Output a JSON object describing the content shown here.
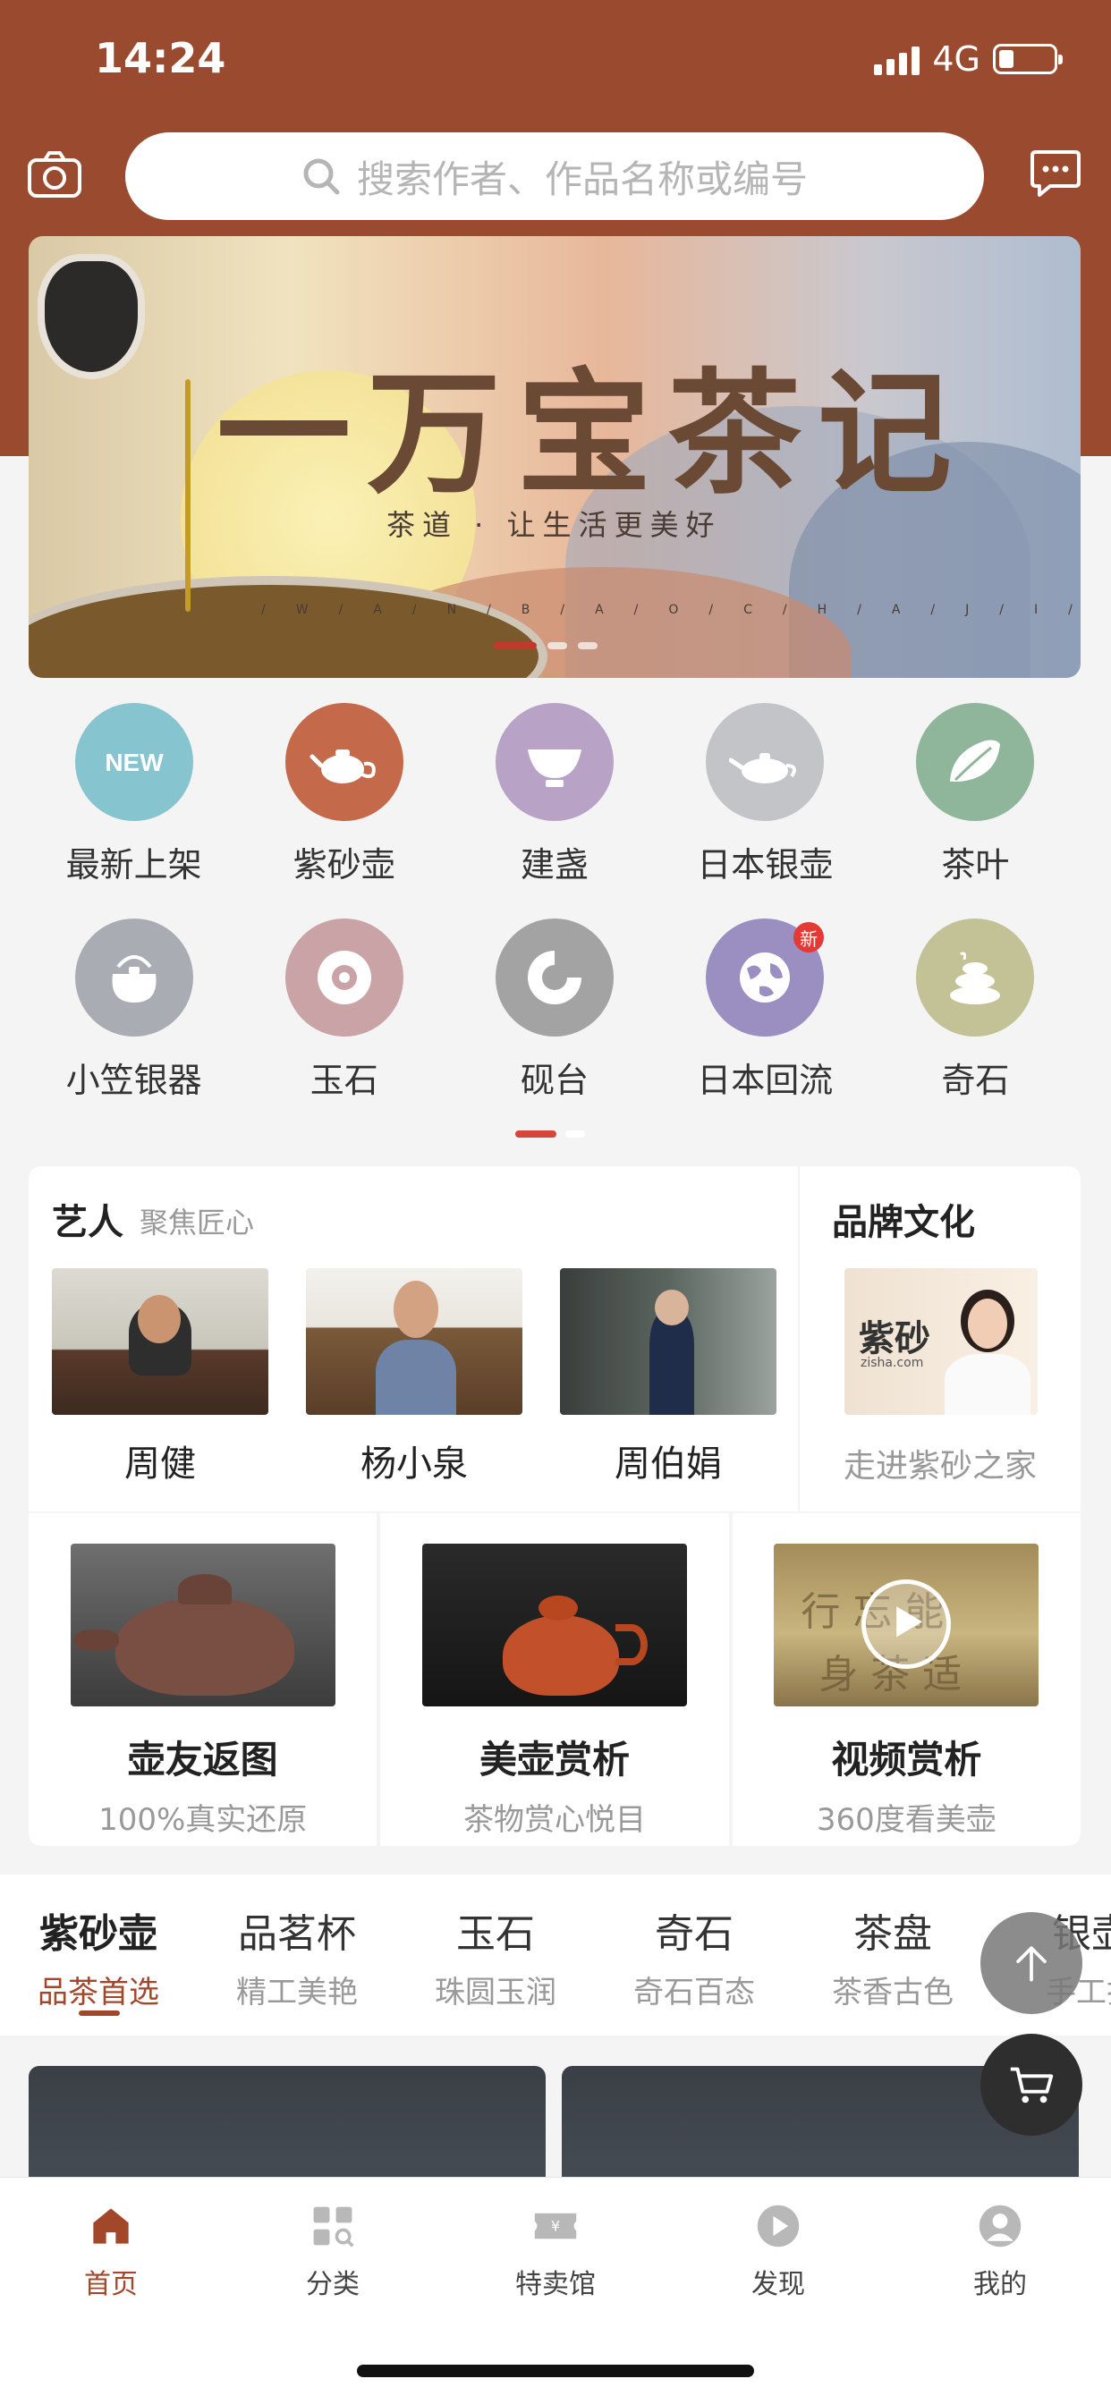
{
  "status": {
    "time": "14:24",
    "network": "4G"
  },
  "header": {
    "search_placeholder": "搜索作者、作品名称或编号"
  },
  "banner": {
    "title": "一万宝茶记",
    "subtitle": "茶道 · 让生活更美好",
    "letters": "/W/A/N/B/A/O/C/H/A/J/I/"
  },
  "categories": [
    {
      "label": "最新上架",
      "icon": "new-icon",
      "color": "#86c4cf"
    },
    {
      "label": "紫砂壶",
      "icon": "teapot-icon",
      "color": "#c46a4a"
    },
    {
      "label": "建盏",
      "icon": "tea-bowl-icon",
      "color": "#b8a3c7"
    },
    {
      "label": "日本银壶",
      "icon": "silver-pot-icon",
      "color": "#c2c4c8"
    },
    {
      "label": "茶叶",
      "icon": "tea-leaf-icon",
      "color": "#8fb59a"
    },
    {
      "label": "小笠银器",
      "icon": "kettle-icon",
      "color": "#a9adb3"
    },
    {
      "label": "玉石",
      "icon": "jade-icon",
      "color": "#c9a3a6"
    },
    {
      "label": "砚台",
      "icon": "inkstone-icon",
      "color": "#a3a3a3"
    },
    {
      "label": "日本回流",
      "icon": "globe-icon",
      "color": "#9a8fc0",
      "badge": "新"
    },
    {
      "label": "奇石",
      "icon": "stones-icon",
      "color": "#c3c296"
    }
  ],
  "artists_section": {
    "title": "艺人",
    "subtitle": "聚焦匠心",
    "artists": [
      {
        "name": "周健"
      },
      {
        "name": "杨小泉"
      },
      {
        "name": "周伯娟"
      }
    ]
  },
  "brand_section": {
    "title": "品牌文化",
    "subtitle": "走进紫砂之家",
    "logo_text": "紫砂",
    "site": "zisha.com"
  },
  "features": [
    {
      "title": "壶友返图",
      "subtitle": "100%真实还原"
    },
    {
      "title": "美壶赏析",
      "subtitle": "茶物赏心悦目"
    },
    {
      "title": "视频赏析",
      "subtitle": "360度看美壶"
    }
  ],
  "tabs": [
    {
      "name": "紫砂壶",
      "sub": "品茶首选"
    },
    {
      "name": "品茗杯",
      "sub": "精工美艳"
    },
    {
      "name": "玉石",
      "sub": "珠圆玉润"
    },
    {
      "name": "奇石",
      "sub": "奇石百态"
    },
    {
      "name": "茶盘",
      "sub": "茶香古色"
    },
    {
      "name": "银壶",
      "sub": "手工打"
    }
  ],
  "bottom_nav": [
    {
      "label": "首页",
      "icon": "home-icon"
    },
    {
      "label": "分类",
      "icon": "category-icon"
    },
    {
      "label": "特卖馆",
      "icon": "ticket-icon"
    },
    {
      "label": "发现",
      "icon": "play-icon"
    },
    {
      "label": "我的",
      "icon": "user-icon"
    }
  ],
  "colors": {
    "brand": "#9a4a2e",
    "accent": "#a3472a",
    "badge": "#e53935"
  }
}
